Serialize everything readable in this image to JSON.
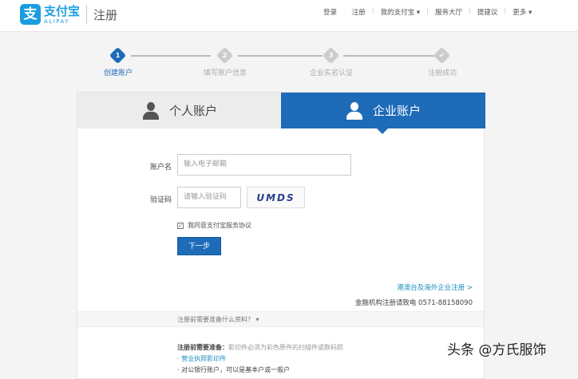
{
  "header": {
    "logo_cn": "支付宝",
    "logo_en": "ALIPAY",
    "page_title": "注册",
    "nav": [
      "登录",
      "注册",
      "我的支付宝 ▾",
      "服务大厅",
      "提建议",
      "更多 ▾"
    ]
  },
  "steps": [
    {
      "num": "1",
      "label": "创建账户"
    },
    {
      "num": "2",
      "label": "填写账户信息"
    },
    {
      "num": "3",
      "label": "企业实名认证"
    },
    {
      "num": "✔",
      "label": "注册成功"
    }
  ],
  "tabs": {
    "personal": "个人账户",
    "enterprise": "企业账户"
  },
  "form": {
    "account_label": "账户名",
    "account_placeholder": "输入电子邮箱",
    "captcha_label": "验证码",
    "captcha_placeholder": "请输入验证码",
    "captcha_text": "UMDS",
    "agree": "我同意支付宝服务协议",
    "next": "下一步"
  },
  "links": {
    "overseas": "港澳台及海外企业注册 >",
    "finance": "金融机构注册请致电 0571-88158090"
  },
  "prep": {
    "toggle": "注册前需要准备什么资料？ ▾",
    "title": "注册前需要准备：",
    "note": "影印件必须为彩色原件的扫描件或数码照",
    "item1": "· 营业执照影印件",
    "item2": "· 对公银行账户，可以是基本户或一般户"
  },
  "watermark": "头条 @方氏服饰"
}
